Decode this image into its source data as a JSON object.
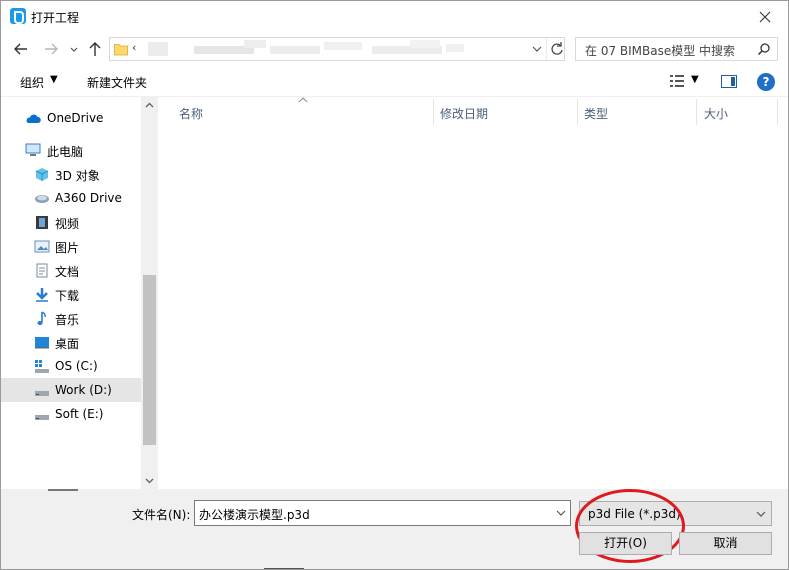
{
  "window": {
    "title": "打开工程",
    "close_icon": "close-icon"
  },
  "navigation": {
    "back_icon": "arrow-left-icon",
    "forward_icon": "arrow-right-icon",
    "recent_icon": "chevron-down-icon",
    "up_icon": "arrow-up-icon",
    "path_separator": "‹",
    "refresh_icon": "refresh-icon",
    "search_placeholder": "在 07 BIMBase模型 中搜索",
    "search_icon": "search-icon"
  },
  "toolbar": {
    "organize_label": "组织",
    "organize_caret": "▼",
    "new_folder_label": "新建文件夹",
    "view_caret": "▼",
    "help_label": "?"
  },
  "sidebar": {
    "items": [
      {
        "label": "OneDrive",
        "icon": "cloud-icon"
      },
      {
        "label": "此电脑",
        "icon": "computer-icon"
      },
      {
        "label": "3D 对象",
        "icon": "cube-icon"
      },
      {
        "label": "A360 Drive",
        "icon": "cloud-drive-icon"
      },
      {
        "label": "视频",
        "icon": "video-icon"
      },
      {
        "label": "图片",
        "icon": "picture-icon"
      },
      {
        "label": "文档",
        "icon": "document-icon"
      },
      {
        "label": "下载",
        "icon": "download-icon"
      },
      {
        "label": "音乐",
        "icon": "music-icon"
      },
      {
        "label": "桌面",
        "icon": "desktop-icon"
      },
      {
        "label": "OS (C:)",
        "icon": "os-drive-icon"
      },
      {
        "label": "Work (D:)",
        "icon": "drive-icon",
        "selected": true
      },
      {
        "label": "Soft (E:)",
        "icon": "drive-icon"
      }
    ]
  },
  "file_list": {
    "columns": [
      {
        "label": "名称"
      },
      {
        "label": "修改日期"
      },
      {
        "label": "类型"
      },
      {
        "label": "大小"
      }
    ]
  },
  "bottom": {
    "filename_label": "文件名(N):",
    "filename_value": "办公楼演示模型.p3d",
    "filetype_value": "p3d File (*.p3d)",
    "open_label": "打开(O)",
    "cancel_label": "取消"
  },
  "colors": {
    "accent": "#1f6fc9",
    "selection": "#e5e5e5",
    "highlight_circle": "#e0191e",
    "header_text": "#4c607a"
  }
}
